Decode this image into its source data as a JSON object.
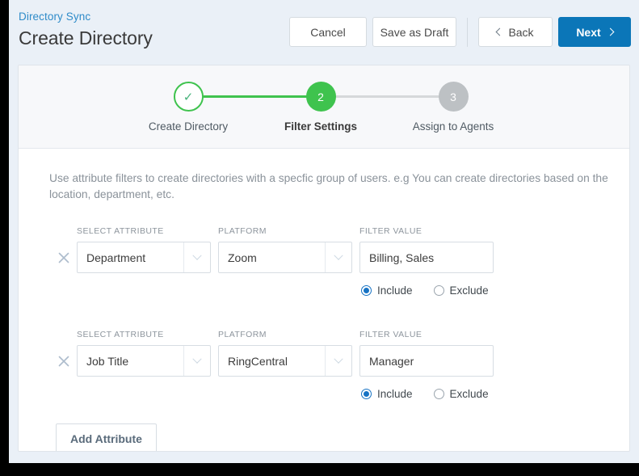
{
  "header": {
    "breadcrumb": "Directory Sync",
    "title": "Create Directory",
    "buttons": {
      "cancel": "Cancel",
      "save_draft": "Save as Draft",
      "back": "Back",
      "next": "Next"
    }
  },
  "stepper": {
    "steps": [
      {
        "marker": "✓",
        "label": "Create Directory",
        "state": "done"
      },
      {
        "marker": "2",
        "label": "Filter Settings",
        "state": "active"
      },
      {
        "marker": "3",
        "label": "Assign to Agents",
        "state": "todo"
      }
    ]
  },
  "body": {
    "description": "Use attribute filters to create directories with a specfic group of users. e.g You can create directories based on the location, department, etc.",
    "labels": {
      "select_attribute": "SELECT ATTRIBUTE",
      "platform": "PLATFORM",
      "filter_value": "FILTER VALUE"
    },
    "rows": [
      {
        "attribute": "Department",
        "platform": "Zoom",
        "filter_value": "Billing, Sales",
        "filter_placeholder": "",
        "include_label": "Include",
        "exclude_label": "Exclude",
        "mode": "include"
      },
      {
        "attribute": "Job Title",
        "platform": "RingCentral",
        "filter_value": "Manager",
        "filter_placeholder": "",
        "include_label": "Include",
        "exclude_label": "Exclude",
        "mode": "include"
      }
    ],
    "add_attribute": "Add Attribute"
  },
  "colors": {
    "accent_blue": "#0b76b8",
    "link_blue": "#2e8bc9",
    "step_green": "#3fc34e",
    "step_gray": "#bdc1c4",
    "radio_blue": "#1773c4"
  }
}
